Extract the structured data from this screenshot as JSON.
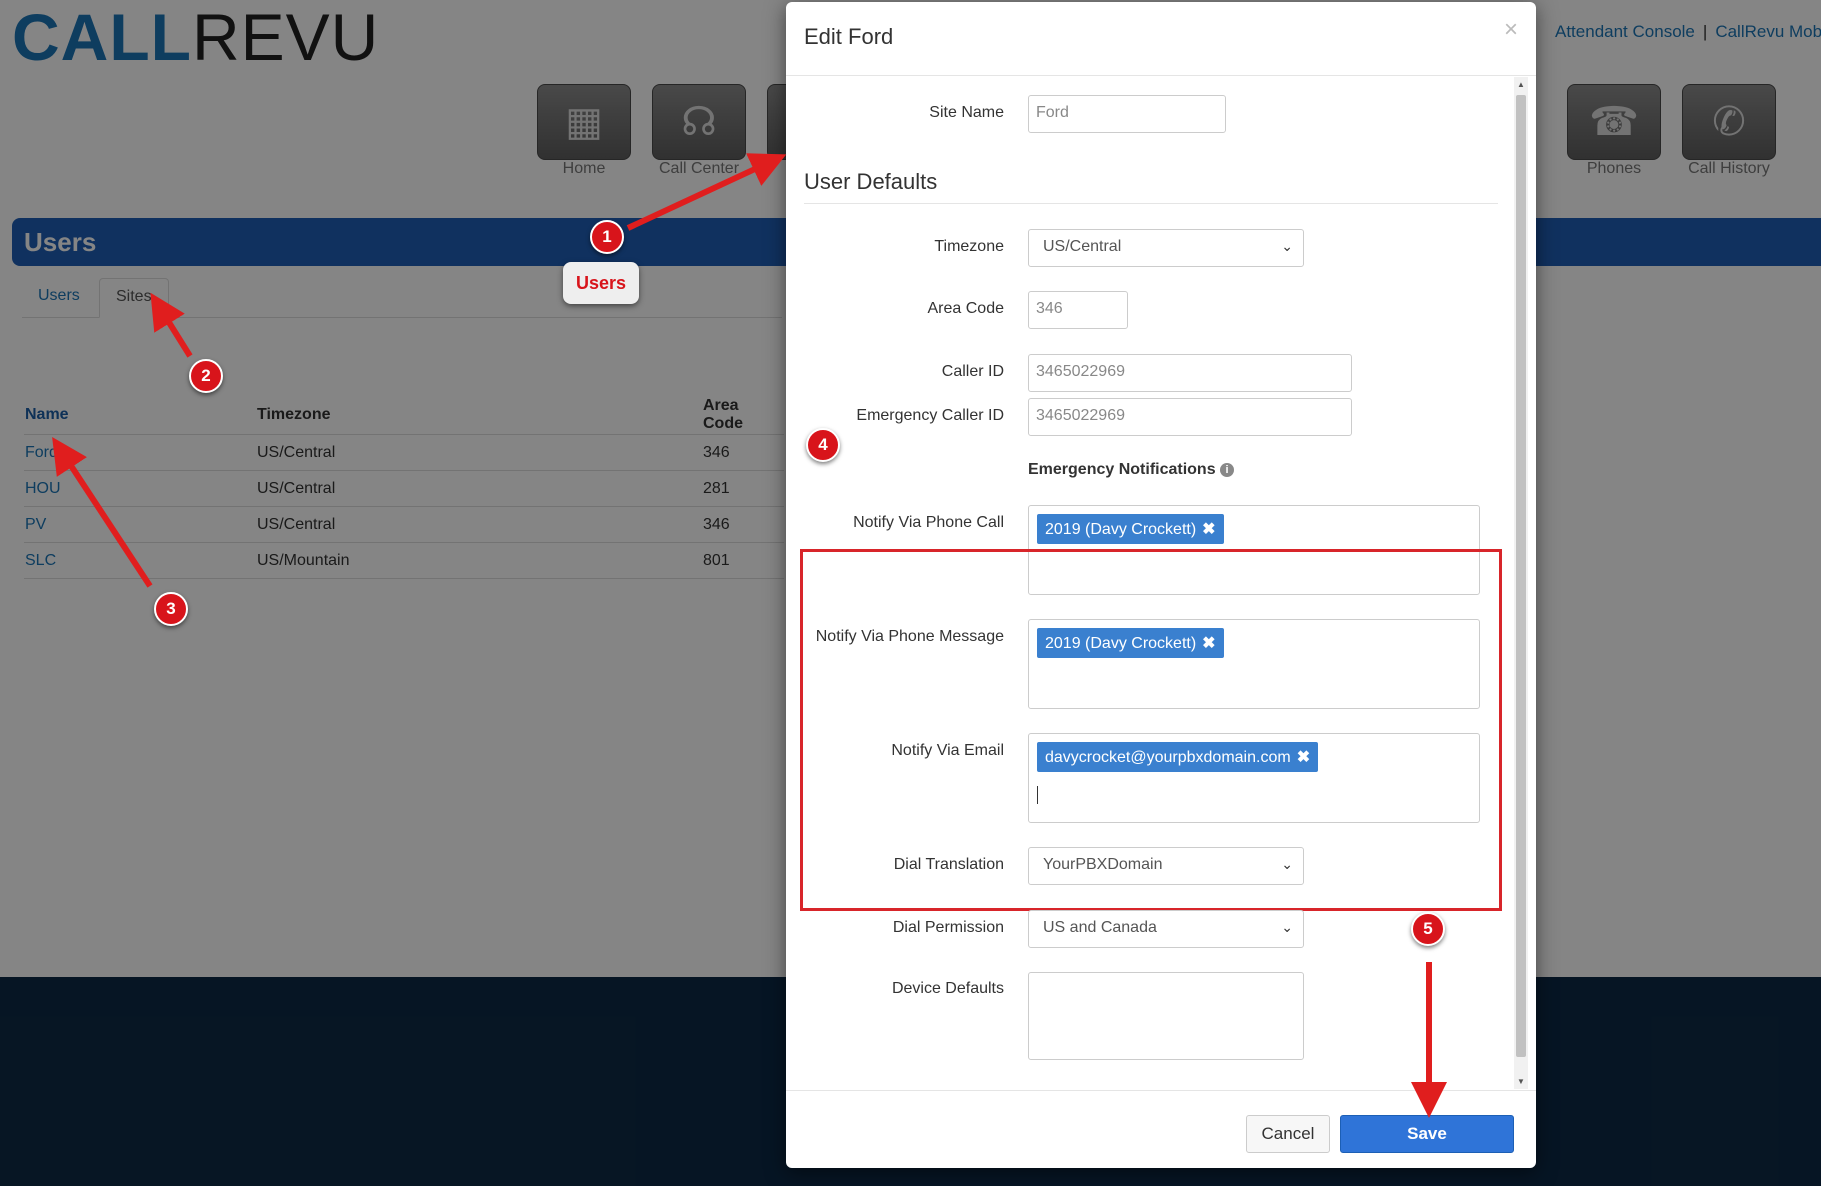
{
  "app": {
    "logo_part1": "CALL",
    "logo_part2": "REVU",
    "top_links": [
      "Attendant Console",
      "CallRevu Mobil"
    ],
    "top_links_sep": "|"
  },
  "nav": [
    {
      "label": "Home",
      "icon": "building-icon"
    },
    {
      "label": "Call Center",
      "icon": "headset-icon"
    },
    {
      "label": "Phones",
      "icon": "phone-icon"
    },
    {
      "label": "Call History",
      "icon": "call-history-icon"
    }
  ],
  "page": {
    "title": "Users",
    "tabs": [
      "Users",
      "Sites"
    ],
    "active_tab": "Sites",
    "table": {
      "headers": [
        "Name",
        "Timezone",
        "Area Code"
      ],
      "rows": [
        [
          "Ford",
          "US/Central",
          "346"
        ],
        [
          "HOU",
          "US/Central",
          "281"
        ],
        [
          "PV",
          "US/Central",
          "346"
        ],
        [
          "SLC",
          "US/Mountain",
          "801"
        ]
      ]
    }
  },
  "modal": {
    "title": "Edit Ford",
    "close": "×",
    "site_name_label": "Site Name",
    "site_name_value": "Ford",
    "section_title": "User Defaults",
    "timezone_label": "Timezone",
    "timezone_value": "US/Central",
    "area_code_label": "Area Code",
    "area_code_value": "346",
    "caller_id_label": "Caller ID",
    "caller_id_value": "3465022969",
    "emergency_caller_id_label": "Emergency Caller ID",
    "emergency_caller_id_value": "3465022969",
    "emergency_notifications_label": "Emergency Notifications",
    "notify_call_label": "Notify Via Phone Call",
    "notify_call_tag": "2019 (Davy Crockett)",
    "notify_message_label": "Notify Via Phone Message",
    "notify_message_tag": "2019 (Davy Crockett)",
    "notify_email_label": "Notify Via Email",
    "notify_email_tag": "davycrocket@yourpbxdomain.com",
    "dial_translation_label": "Dial Translation",
    "dial_translation_value": "YourPBXDomain",
    "dial_permission_label": "Dial Permission",
    "dial_permission_value": "US and Canada",
    "device_defaults_label": "Device Defaults",
    "cancel_label": "Cancel",
    "save_label": "Save"
  },
  "annotations": {
    "callout_label": "Users",
    "badges": [
      "1",
      "2",
      "3",
      "4",
      "5"
    ],
    "highlight_color": "#d8252a"
  },
  "colors": {
    "brand_blue": "#1c76b7",
    "title_bar": "#1f5fb6",
    "save_button": "#2f74d8",
    "tag": "#3a80cf",
    "annotation_red": "#d8141b"
  }
}
